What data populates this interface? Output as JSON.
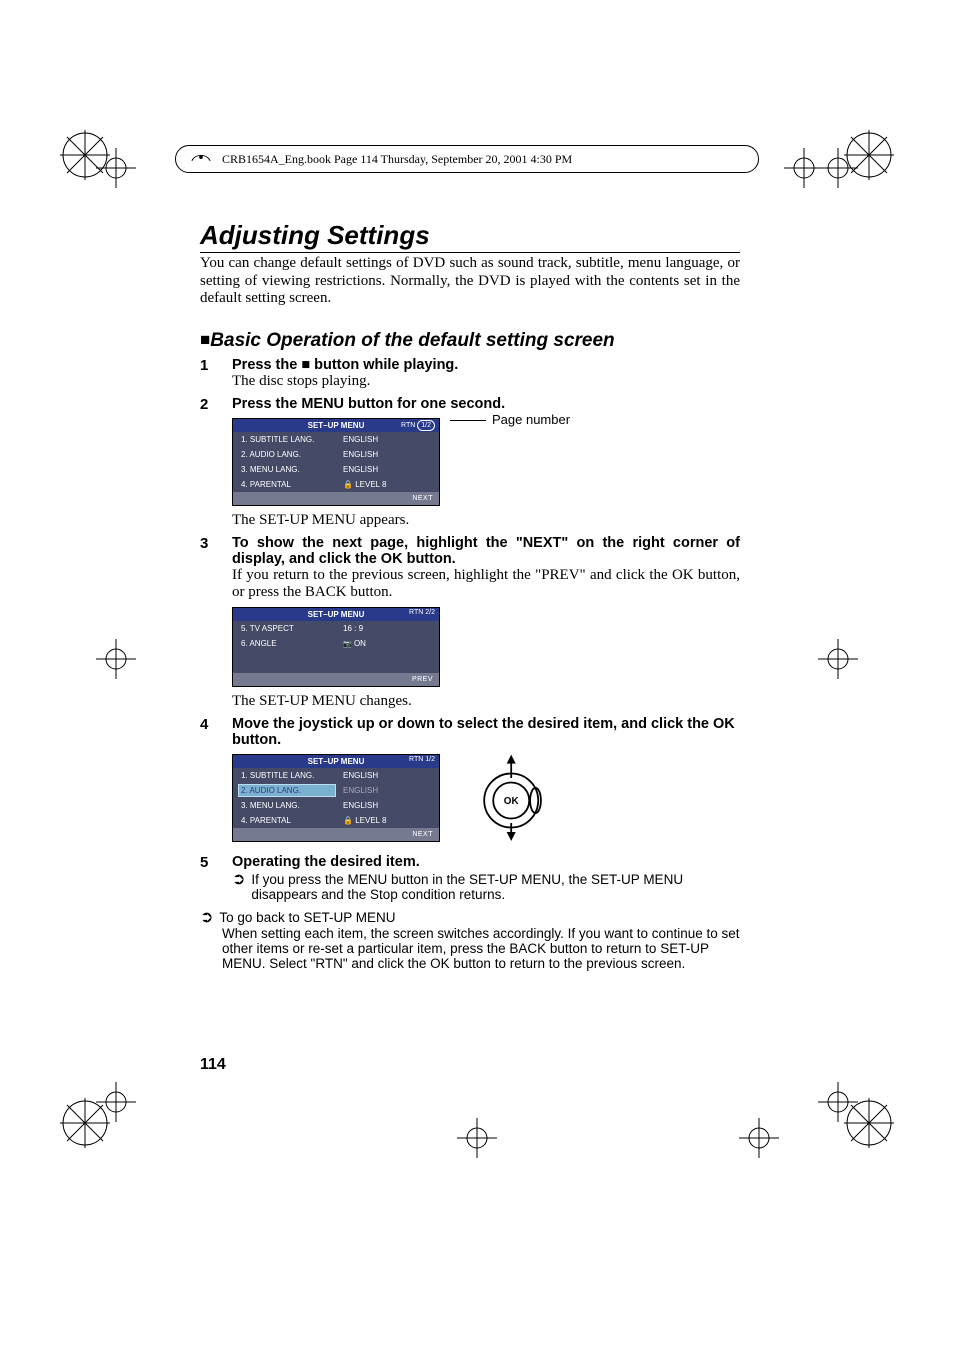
{
  "print_header": "CRB1654A_Eng.book  Page 114  Thursday, September 20, 2001  4:30 PM",
  "title": "Adjusting Settings",
  "intro": "You can change default settings of DVD such as sound track, subtitle, menu language, or setting of viewing restrictions. Normally, the DVD is played with the contents set in the default setting screen.",
  "section_title": "Basic Operation of the default setting screen",
  "steps": {
    "s1": {
      "num": "1",
      "bold_a": "Press the ",
      "bold_b": " button while playing.",
      "plain": "The disc stops playing."
    },
    "s2": {
      "num": "2",
      "bold": "Press the MENU button for one second.",
      "after": "The SET-UP MENU appears.",
      "page_label": "Page number"
    },
    "s3": {
      "num": "3",
      "bold": "To show the next page, highlight the \"NEXT\" on the right corner of display, and click the OK button.",
      "plain": "If you return to the previous screen, highlight the \"PREV\" and click the OK button, or press the BACK button.",
      "after": "The SET-UP MENU changes."
    },
    "s4": {
      "num": "4",
      "bold": "Move the joystick up or down to select the desired item, and click the OK button."
    },
    "s5": {
      "num": "5",
      "bold": "Operating the desired item.",
      "note1": "If you press the MENU button in the SET-UP MENU, the SET-UP MENU disappears and the Stop condition returns.",
      "note2_title": "To go back to SET-UP MENU",
      "note2_body": "When setting each item, the screen switches accordingly. If you want to continue to set other items or re-set a particular item, press the BACK button to return to SET-UP MENU. Select \"RTN\" and click the OK button to return to the previous screen."
    }
  },
  "menu1": {
    "title": "SET–UP MENU",
    "rtn": "RTN",
    "page": "1/2",
    "rows": [
      {
        "k": "1. SUBTITLE LANG.",
        "v": "ENGLISH"
      },
      {
        "k": "2. AUDIO LANG.",
        "v": "ENGLISH"
      },
      {
        "k": "3. MENU LANG.",
        "v": "ENGLISH"
      },
      {
        "k": "4. PARENTAL",
        "v": "LEVEL 8",
        "lock": true
      }
    ],
    "footer": "NEXT"
  },
  "menu2": {
    "title": "SET–UP MENU",
    "rtn": "RTN",
    "page": "2/2",
    "rows": [
      {
        "k": "5. TV ASPECT",
        "v": "16 : 9"
      },
      {
        "k": "6. ANGLE",
        "v": "ON",
        "cam": true
      }
    ],
    "footer": "PREV"
  },
  "menu3": {
    "title": "SET–UP MENU",
    "rtn": "RTN",
    "page": "1/2",
    "rows": [
      {
        "k": "1. SUBTITLE LANG.",
        "v": "ENGLISH"
      },
      {
        "k": "2. AUDIO LANG.",
        "v": "ENGLISH",
        "sel": true
      },
      {
        "k": "3. MENU LANG.",
        "v": "ENGLISH"
      },
      {
        "k": "4. PARENTAL",
        "v": "LEVEL 8",
        "lock": true
      }
    ],
    "footer": "NEXT"
  },
  "page_number": "114"
}
